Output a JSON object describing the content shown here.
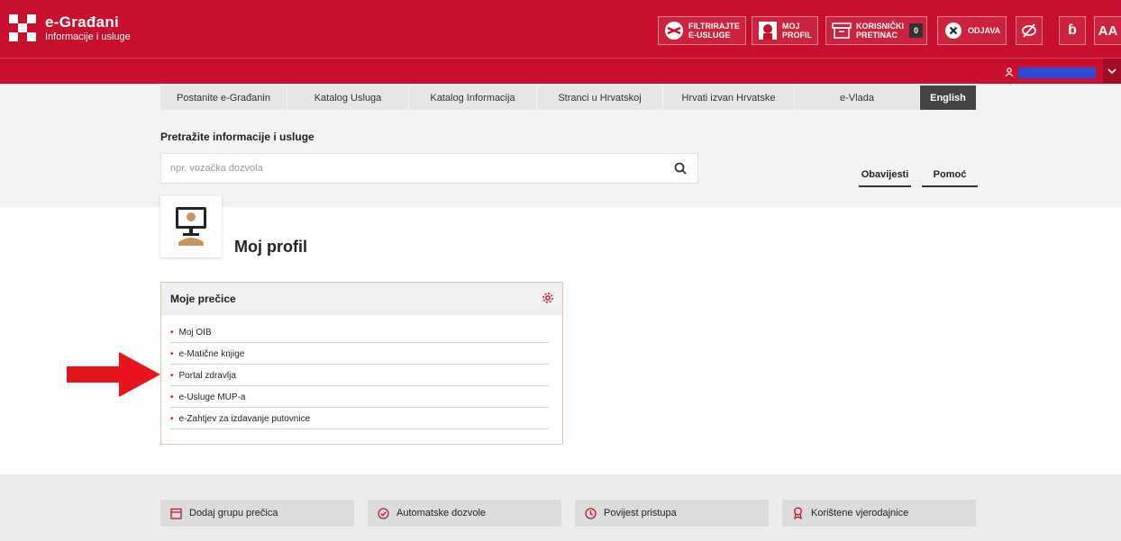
{
  "header": {
    "title": "e-Građani",
    "subtitle": "Informacije i usluge",
    "buttons": {
      "filter_line1": "FILTRIRAJTE",
      "filter_line2": "E-USLUGE",
      "profile_line1": "MOJ",
      "profile_line2": "PROFIL",
      "inbox_line1": "KORISNIČKI",
      "inbox_line2": "PRETINAC",
      "inbox_count": "0",
      "logout": "ODJAVA",
      "dyslexia": "ɓ",
      "font_size": "AA"
    }
  },
  "nav": {
    "tabs": [
      {
        "label": "Postanite e-Građanin"
      },
      {
        "label": "Katalog Usluga"
      },
      {
        "label": "Katalog Informacija"
      },
      {
        "label": "Stranci u Hrvatskoj"
      },
      {
        "label": "Hrvati izvan Hrvatske"
      },
      {
        "label": "e-Vlada"
      },
      {
        "label": "English"
      }
    ]
  },
  "search": {
    "title": "Pretražite informacije i usluge",
    "placeholder": "npr. vozačka dozvola"
  },
  "util_links": {
    "notices": "Obavijesti",
    "help": "Pomoć"
  },
  "profile": {
    "title": "Moj profil"
  },
  "shortcuts": {
    "title": "Moje prečice",
    "items": [
      {
        "label": "Moj OIB"
      },
      {
        "label": "e-Matične knjige"
      },
      {
        "label": "Portal zdravlja"
      },
      {
        "label": "e-Usluge MUP-a"
      },
      {
        "label": "e-Zahtjev za izdavanje putovnice"
      }
    ]
  },
  "footer": {
    "add_group": "Dodaj grupu prečica",
    "auto_permissions": "Automatske dozvole",
    "history": "Povijest pristupa",
    "credentials": "Korištene vjerodajnice"
  },
  "colors": {
    "brand_red": "#c8102e",
    "nav_dark": "#444444"
  }
}
